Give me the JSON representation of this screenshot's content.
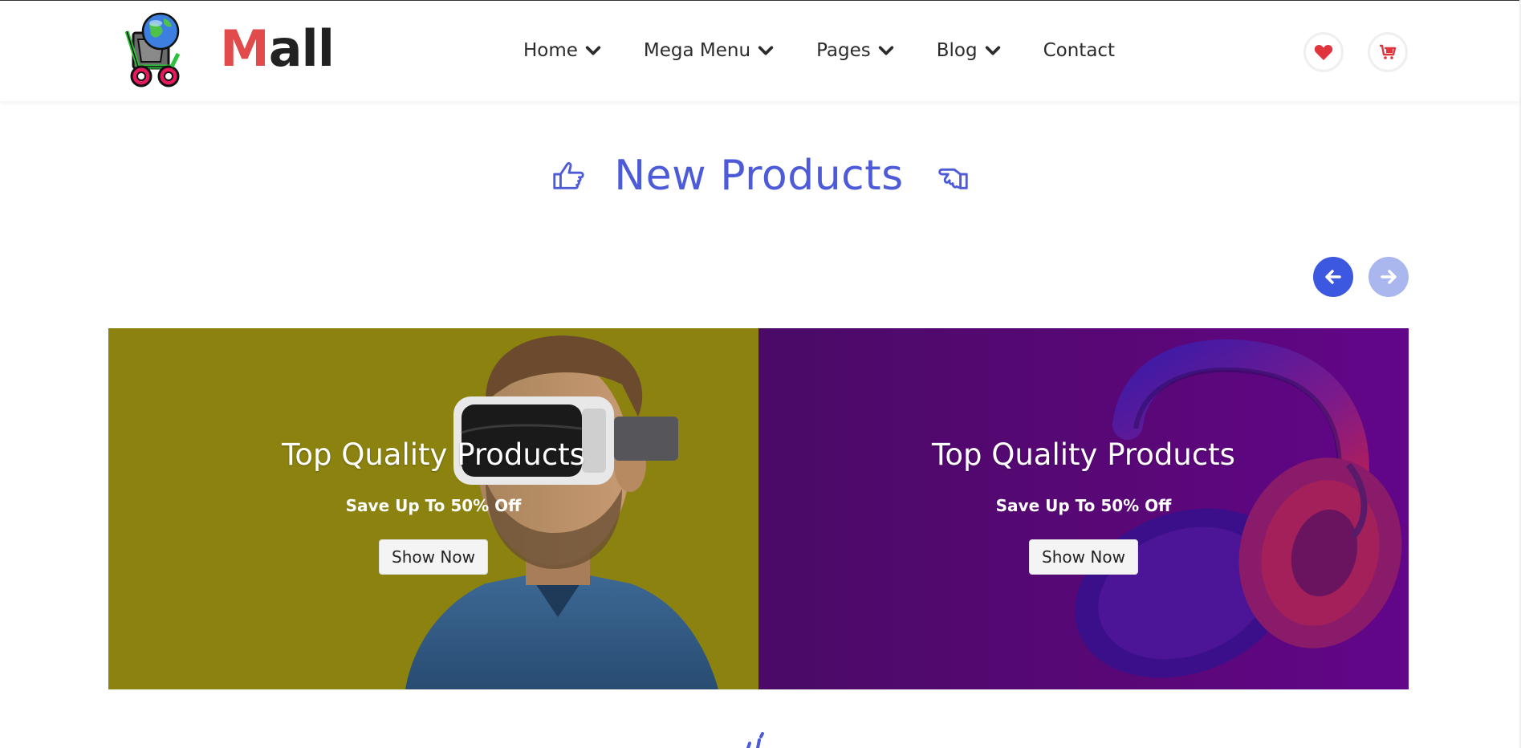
{
  "header": {
    "brand_first": "M",
    "brand_rest": "all",
    "nav": [
      {
        "label": "Home",
        "has_dropdown": true
      },
      {
        "label": "Mega Menu",
        "has_dropdown": true
      },
      {
        "label": "Pages",
        "has_dropdown": true
      },
      {
        "label": "Blog",
        "has_dropdown": true
      },
      {
        "label": "Contact",
        "has_dropdown": false
      }
    ],
    "icons": {
      "wishlist": "heart-icon",
      "cart": "cart-icon"
    }
  },
  "section": {
    "title": "New Products"
  },
  "carousel": {
    "prev_icon": "arrow-left-icon",
    "next_icon": "arrow-right-icon"
  },
  "banners": [
    {
      "title": "Top Quality Products",
      "subtitle": "Save Up To 50% Off",
      "button": "Show Now",
      "bg": "#8b820f",
      "image": "vr-headset-man"
    },
    {
      "title": "Top Quality Products",
      "subtitle": "Save Up To 50% Off",
      "button": "Show Now",
      "bg": "#560777",
      "image": "headphones"
    }
  ],
  "colors": {
    "accent": "#4d5bd9",
    "brand_red": "#e24b4b",
    "arrow_active": "#3c57e0",
    "arrow_inactive": "#aab6ee"
  }
}
